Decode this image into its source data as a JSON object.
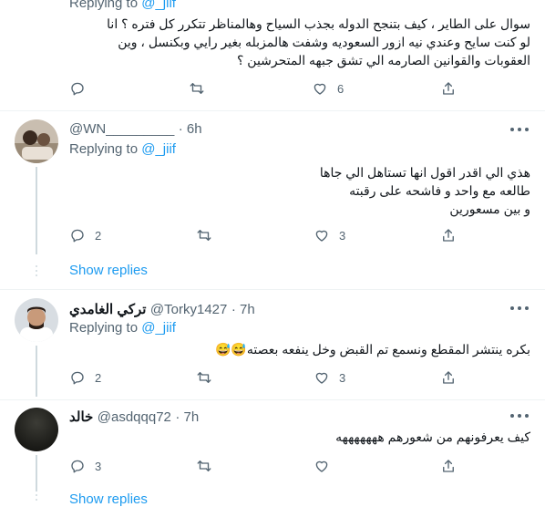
{
  "tweets": [
    {
      "replying_prefix": "Replying to ",
      "replying_handle": "@_jiif",
      "text": "سوال على الطاير ، كيف بتنجح الدوله بجذب السياح وهالمناظر تتكرر كل فتره ؟ انا\nلو كنت سايح وعندي نيه ازور السعوديه وشفت هالمزبله بغير رايي وبكنسل ، وين\nالعقوبات والقوانين الصارمه الي تشق جبهه المتحرشين ؟",
      "replies": "",
      "retweets": "",
      "likes": "6"
    },
    {
      "name": "",
      "handle": "@WN_________",
      "time": "· 6h",
      "replying_prefix": "Replying to ",
      "replying_handle": "@_jiif",
      "text": "هذي الي اقدر اقول انها تستاهل الي جاها\nطالعه مع واحد و فاشحه على رقبته\nو بين مسعورين",
      "replies": "2",
      "retweets": "",
      "likes": "3",
      "show_replies": "Show replies"
    },
    {
      "name": "تركي الغامدي",
      "handle": "@Torky1427",
      "time": "· 7h",
      "replying_prefix": "Replying to ",
      "replying_handle": "@_jiif",
      "text": "بكره ينتشر المقطع ونسمع تم القبض وخل ينفعه بعصته😅😅",
      "replies": "2",
      "retweets": "",
      "likes": "3"
    },
    {
      "name": "خالد",
      "handle": "@asdqqq72",
      "time": "· 7h",
      "text": "كيف يعرفونهم من شعورهم هههههههه",
      "replies": "3",
      "retweets": "",
      "likes": "",
      "show_replies": "Show replies"
    }
  ],
  "icons": [
    "reply-icon",
    "retweet-icon",
    "like-icon",
    "share-icon",
    "more-icon"
  ],
  "colors": {
    "link": "#1d9bf0",
    "secondary": "#536471",
    "divider": "#eff3f4"
  }
}
